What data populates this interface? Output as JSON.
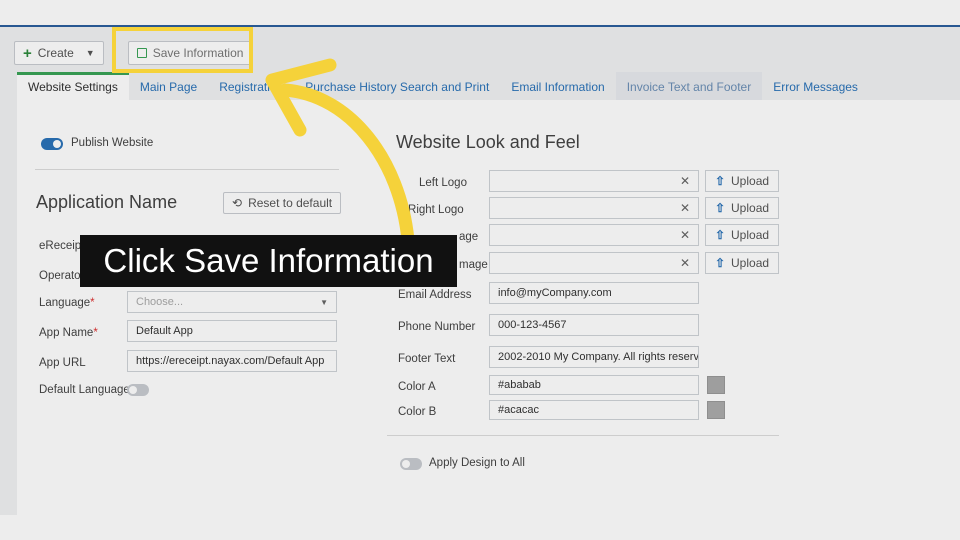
{
  "toolbar": {
    "create_label": "Create",
    "save_label": "Save Information"
  },
  "tabs": [
    {
      "label": "Website Settings"
    },
    {
      "label": "Main Page"
    },
    {
      "label": "Registration"
    },
    {
      "label": "Purchase History Search and Print"
    },
    {
      "label": "Email Information"
    },
    {
      "label": "Invoice Text and Footer"
    },
    {
      "label": "Error Messages"
    }
  ],
  "left": {
    "publish_label": "Publish Website",
    "app_name_title": "Application Name",
    "reset_label": "Reset to default",
    "fields": {
      "ereceipt_label": "eReceipt",
      "operator_label": "Operato",
      "language_label": "Language",
      "language_placeholder": "Choose...",
      "app_name_label": "App Name",
      "app_name_value": "Default App",
      "app_url_label": "App URL",
      "app_url_value": "https://ereceipt.nayax.com/Default App",
      "default_language_label": "Default Language"
    },
    "required_mark": "*"
  },
  "right": {
    "title": "Website Look and Feel",
    "top_left_logo_label": "Left Logo",
    "top_right_logo_label": "T Right Logo",
    "image1_label": "age",
    "image2_label": "mage",
    "upload_label": "Upload",
    "clear_glyph": "✕",
    "email_label": "Email Address",
    "email_value": "info@myCompany.com",
    "phone_label": "Phone Number",
    "phone_value": "000-123-4567",
    "footer_label": "Footer Text",
    "footer_value": "2002-2010 My Company. All rights reserv",
    "color_a_label": "Color A",
    "color_a_value": "#ababab",
    "color_b_label": "Color B",
    "color_b_value": "#acacac",
    "apply_design_label": "Apply Design to All"
  },
  "tutorial": {
    "callout_text": "Click Save Information",
    "highlight_color": "#f5d23a"
  },
  "icons": [
    "plus-icon",
    "caret-down-icon",
    "save-icon",
    "reset-icon",
    "upload-icon",
    "clear-icon",
    "select-caret-icon",
    "curved-arrow-icon"
  ]
}
